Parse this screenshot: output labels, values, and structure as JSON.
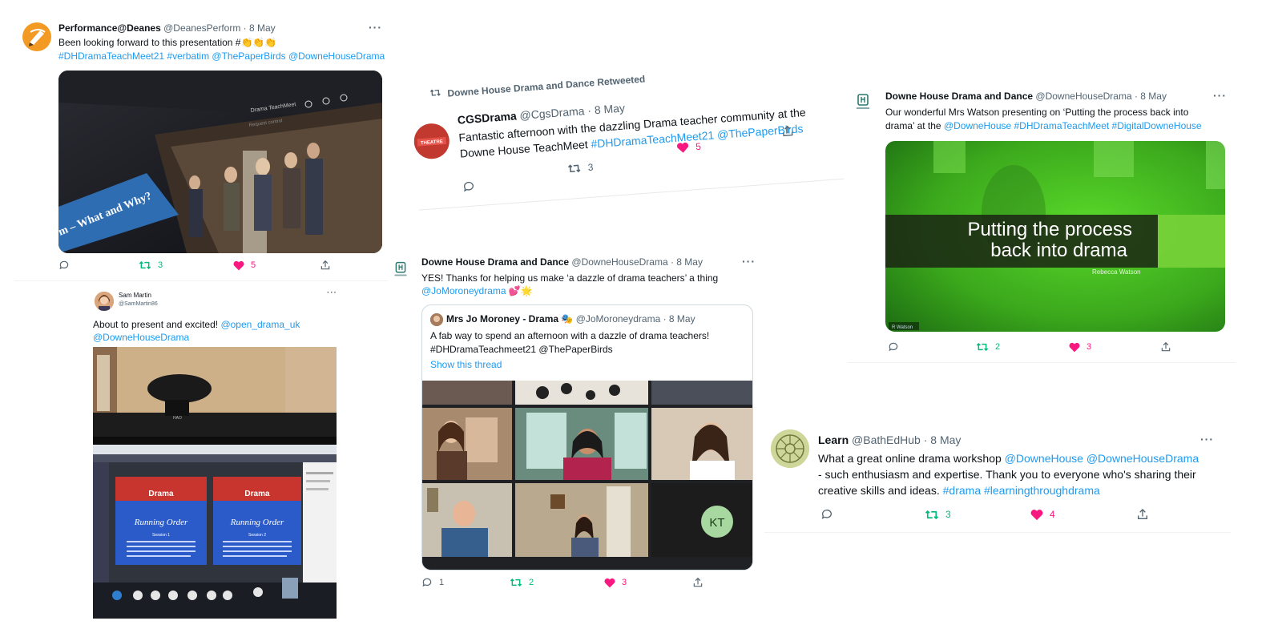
{
  "t1": {
    "name": "Performance@Deanes",
    "handle": "@DeanesPerform · 8 May",
    "text1": "Been looking forward to this presentation #",
    "text2": "#DHDramaTeachMeet21 #verbatim @ThePaperBirds @DowneHouseDrama",
    "media_tab": "Drama TeachMeet",
    "media_sub": "Request control",
    "media_overlay": "m – What and Why?",
    "retweets": "3",
    "likes": "5"
  },
  "t2": {
    "retweeted_by": "Downe House Drama and Dance Retweeted",
    "name": "CGSDrama",
    "handle": "@CgsDrama · 8 May",
    "avatar_text": "THEATRE",
    "text1": "Fantastic afternoon with the dazzling Drama teacher community at the",
    "text2a": "Downe House TeachMeet ",
    "text2b": "#DHDramaTeachMeet21 @ThePaperBirds",
    "retweets": "3",
    "likes": "5"
  },
  "t3": {
    "name": "Downe House Drama and Dance",
    "handle": "@DowneHouseDrama · 8 May",
    "text1": "Our wonderful Mrs Watson presenting on ‘Putting the process back into",
    "text2a": "drama’ at the ",
    "text2b": "@DowneHouse #DHDramaTeachMeet #DigitalDowneHouse",
    "slide_title1": "Putting the process",
    "slide_title2": "back into drama",
    "slide_sub": "Rebecca Watson",
    "slide_corner": "R Watson",
    "retweets": "2",
    "likes": "3"
  },
  "t4": {
    "name": "Sam Martin",
    "handle": "@SamMartin86",
    "text1a": "About to present and excited! ",
    "text1b": "@open_drama_uk",
    "text2": "@DowneHouseDrama",
    "slide_title": "Drama",
    "slide_heading": "Running Order",
    "session1": "Session 1",
    "session2": "Session 2"
  },
  "t5": {
    "name": "Downe House Drama and Dance",
    "handle": "@DowneHouseDrama · 8 May",
    "text1": "YES! Thanks for helping us make ‘a dazzle of drama teachers’ a thing",
    "text2": "@JoMoroneydrama",
    "quote_name": "Mrs Jo Moroney - Drama",
    "quote_handle": "@JoMoroneydrama · 8 May",
    "quote_text1": "A fab way to spend an afternoon with a dazzle of drama teachers!",
    "quote_text2": "#DHDramaTeachmeet21 @ThePaperBirds",
    "quote_link": "Show this thread",
    "kt": "KT",
    "replies": "1",
    "retweets": "2",
    "likes": "3"
  },
  "t6": {
    "name": "Learn",
    "handle": "@BathEdHub · 8 May",
    "text1a": "What a great online drama workshop ",
    "text1b": "@DowneHouse @DowneHouseDrama",
    "text2": "- such enthusiasm and expertise. Thank you to everyone who's sharing their",
    "text3a": "creative skills and ideas. ",
    "text3b": "#drama #learningthroughdrama",
    "retweets": "3",
    "likes": "4"
  },
  "more": "···"
}
